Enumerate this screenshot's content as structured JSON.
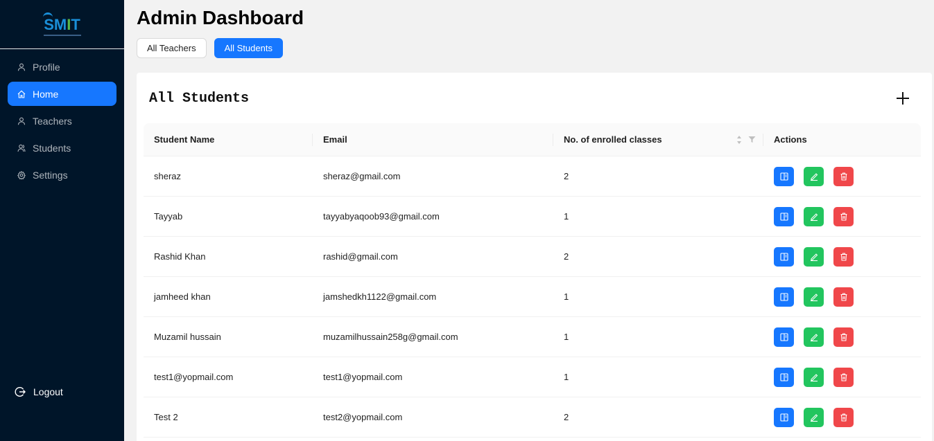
{
  "brand": {
    "logo_text_prefix": "SM",
    "logo_text_mid": "I",
    "logo_text_suffix": "T"
  },
  "sidebar": {
    "items": [
      {
        "label": "Profile",
        "icon": "user-icon",
        "active": false
      },
      {
        "label": "Home",
        "icon": "home-icon",
        "active": true
      },
      {
        "label": "Teachers",
        "icon": "user-icon",
        "active": false
      },
      {
        "label": "Students",
        "icon": "users-icon",
        "active": false
      },
      {
        "label": "Settings",
        "icon": "gear-icon",
        "active": false
      }
    ],
    "logout_label": "Logout"
  },
  "header": {
    "title": "Admin Dashboard",
    "tabs": [
      {
        "label": "All Teachers",
        "active": false
      },
      {
        "label": "All Students",
        "active": true
      }
    ]
  },
  "card": {
    "title": "All Students",
    "columns": [
      "Student Name",
      "Email",
      "No. of enrolled classes",
      "Actions"
    ],
    "rows": [
      {
        "name": "sheraz",
        "email": "sheraz@gmail.com",
        "classes": "2"
      },
      {
        "name": "Tayyab",
        "email": "tayyabyaqoob93@gmail.com",
        "classes": "1"
      },
      {
        "name": "Rashid Khan",
        "email": "rashid@gmail.com",
        "classes": "2"
      },
      {
        "name": "jamheed khan",
        "email": "jamshedkh1122@gmail.com",
        "classes": "1"
      },
      {
        "name": "Muzamil hussain",
        "email": "muzamilhussain258g@gmail.com",
        "classes": "1"
      },
      {
        "name": "test1@yopmail.com",
        "email": "test1@yopmail.com",
        "classes": "1"
      },
      {
        "name": "Test 2",
        "email": "test2@yopmail.com",
        "classes": "2"
      }
    ]
  },
  "colors": {
    "sidebar_bg": "#001529",
    "primary": "#1677ff",
    "success": "#22c55e",
    "danger": "#f0474a"
  }
}
